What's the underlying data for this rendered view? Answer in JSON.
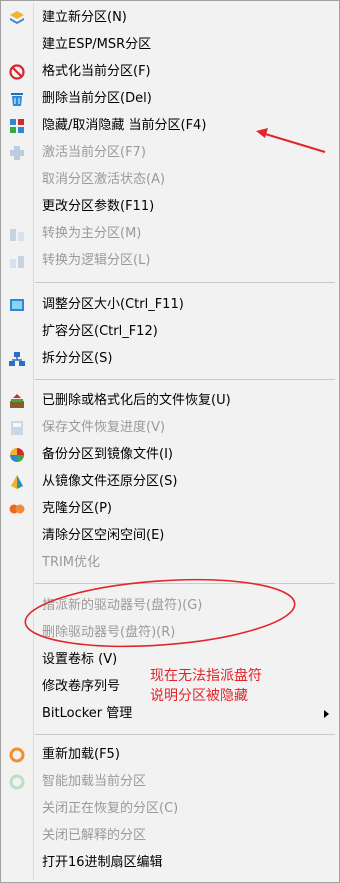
{
  "menu": {
    "items": [
      {
        "label": "建立新分区(N)",
        "icon": "new-partition-icon",
        "enabled": true
      },
      {
        "label": "建立ESP/MSR分区",
        "icon": "",
        "enabled": true
      },
      {
        "label": "格式化当前分区(F)",
        "icon": "format-icon",
        "enabled": true
      },
      {
        "label": "删除当前分区(Del)",
        "icon": "delete-partition-icon",
        "enabled": true
      },
      {
        "label": "隐藏/取消隐藏 当前分区(F4)",
        "icon": "hide-partition-icon",
        "enabled": true
      },
      {
        "label": "激活当前分区(F7)",
        "icon": "activate-partition-icon",
        "enabled": false
      },
      {
        "label": "取消分区激活状态(A)",
        "icon": "",
        "enabled": false
      },
      {
        "label": "更改分区参数(F11)",
        "icon": "",
        "enabled": true
      },
      {
        "label": "转换为主分区(M)",
        "icon": "convert-primary-icon",
        "enabled": false
      },
      {
        "label": "转换为逻辑分区(L)",
        "icon": "convert-logical-icon",
        "enabled": false
      },
      {
        "label": "调整分区大小(Ctrl_F11)",
        "icon": "resize-partition-icon",
        "enabled": true
      },
      {
        "label": "扩容分区(Ctrl_F12)",
        "icon": "",
        "enabled": true
      },
      {
        "label": "拆分分区(S)",
        "icon": "split-partition-icon",
        "enabled": true
      },
      {
        "label": "已删除或格式化后的文件恢复(U)",
        "icon": "file-recovery-icon",
        "enabled": true
      },
      {
        "label": "保存文件恢复进度(V)",
        "icon": "save-progress-icon",
        "enabled": false
      },
      {
        "label": "备份分区到镜像文件(I)",
        "icon": "backup-image-icon",
        "enabled": true
      },
      {
        "label": "从镜像文件还原分区(S)",
        "icon": "restore-image-icon",
        "enabled": true
      },
      {
        "label": "克隆分区(P)",
        "icon": "clone-partition-icon",
        "enabled": true
      },
      {
        "label": "清除分区空闲空间(E)",
        "icon": "",
        "enabled": true
      },
      {
        "label": "TRIM优化",
        "icon": "",
        "enabled": false
      },
      {
        "label": "指派新的驱动器号(盘符)(G)",
        "icon": "",
        "enabled": false
      },
      {
        "label": "删除驱动器号(盘符)(R)",
        "icon": "",
        "enabled": false
      },
      {
        "label": "设置卷标 (V)",
        "icon": "",
        "enabled": true
      },
      {
        "label": "修改卷序列号",
        "icon": "",
        "enabled": true
      },
      {
        "label": "BitLocker 管理",
        "icon": "",
        "enabled": true,
        "submenu": true
      },
      {
        "label": "重新加载(F5)",
        "icon": "reload-icon",
        "enabled": true
      },
      {
        "label": "智能加载当前分区",
        "icon": "smart-load-icon",
        "enabled": false
      },
      {
        "label": "关闭正在恢复的分区(C)",
        "icon": "",
        "enabled": false
      },
      {
        "label": "关闭已解释的分区",
        "icon": "",
        "enabled": false
      },
      {
        "label": "打开16进制扇区编辑",
        "icon": "",
        "enabled": true
      }
    ]
  },
  "annotation": {
    "line1": "现在无法指派盘符",
    "line2": "说明分区被隐藏",
    "color": "#e0262b"
  }
}
